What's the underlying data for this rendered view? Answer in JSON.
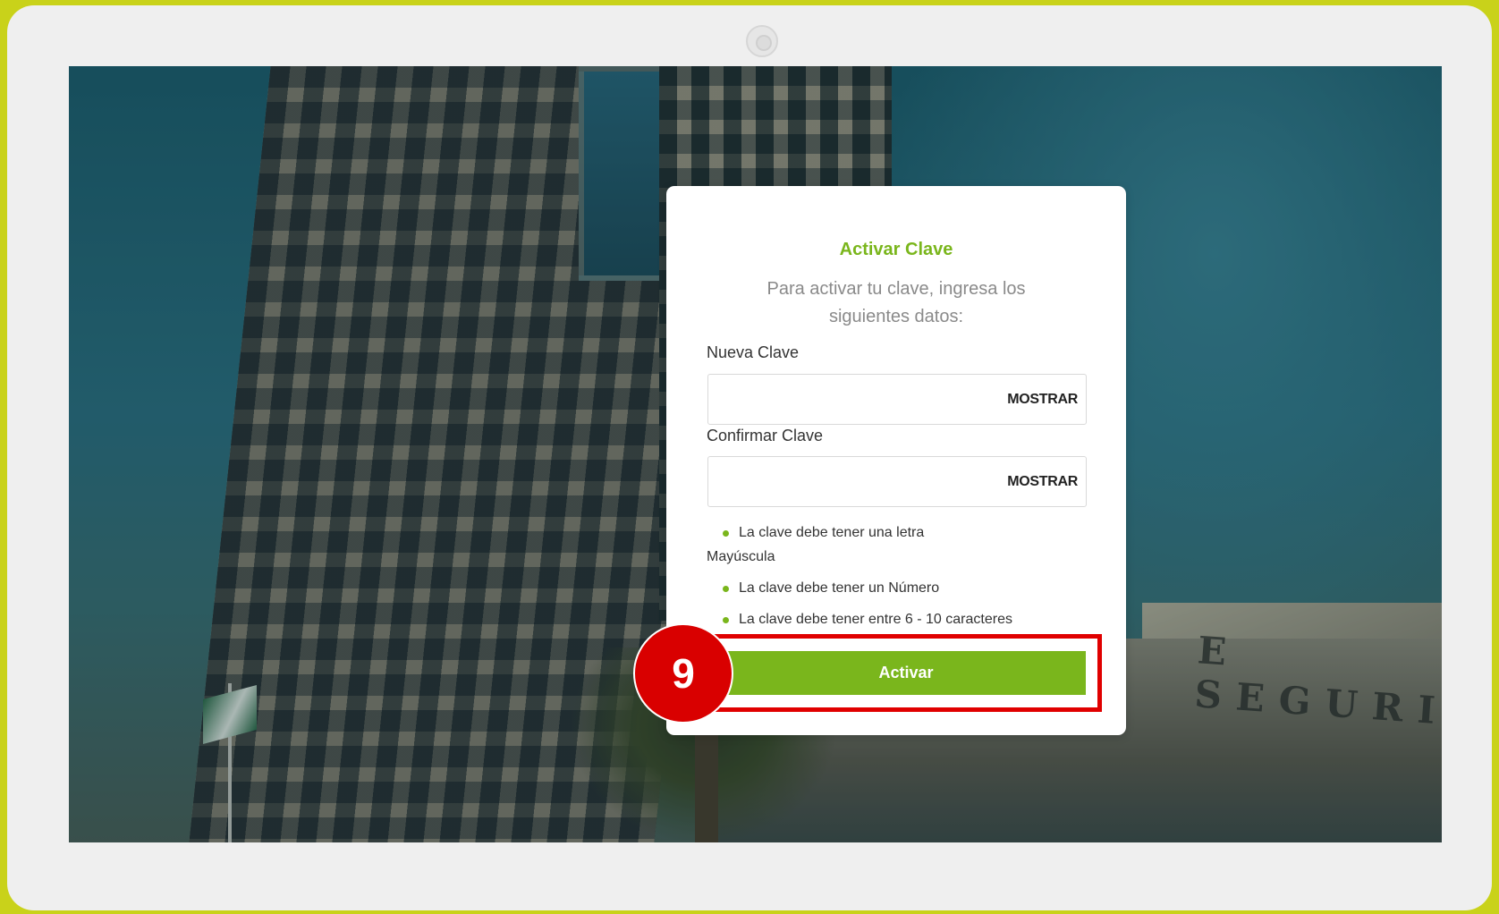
{
  "card": {
    "title": "Activar Clave",
    "subtitle": "Para activar tu clave, ingresa los siguientes datos:"
  },
  "form": {
    "new_password": {
      "label": "Nueva Clave",
      "value": "",
      "toggle_label": "MOSTRAR"
    },
    "confirm_password": {
      "label": "Confirmar Clave",
      "value": "",
      "toggle_label": "MOSTRAR"
    },
    "rules": [
      {
        "text": "La clave debe tener una letra",
        "continuation": "Mayúscula"
      },
      {
        "text": "La clave debe tener un Número"
      },
      {
        "text": "La clave debe tener entre 6 - 10 caracteres"
      }
    ],
    "submit_label": "Activar"
  },
  "annotation": {
    "step_number": "9",
    "highlight_color": "#e00000"
  },
  "background": {
    "sign_text": "E SEGURID"
  },
  "colors": {
    "accent": "#7ab61c",
    "frame": "#c9d21a"
  }
}
